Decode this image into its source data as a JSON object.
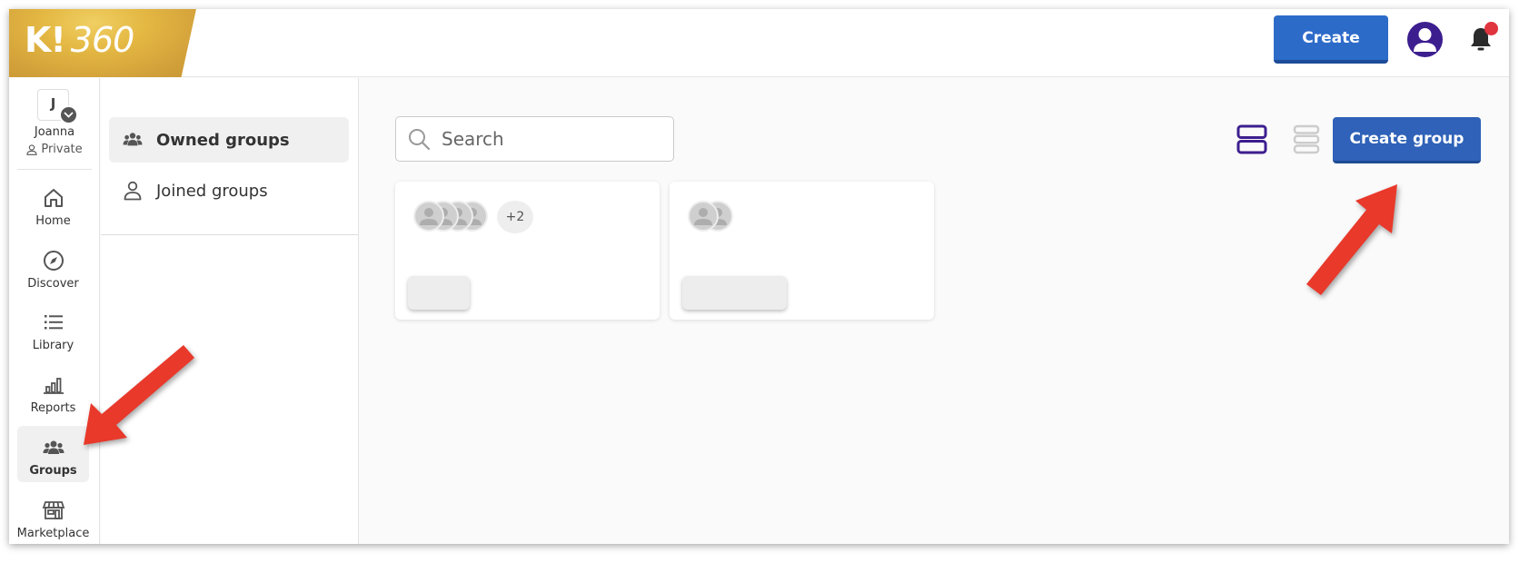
{
  "header": {
    "logo_k": "K!",
    "logo_num": "360",
    "create_label": "Create",
    "notification_dot_color": "#e0343f"
  },
  "user": {
    "initial": "J",
    "name": "Joanna",
    "privacy": "Private"
  },
  "nav": {
    "items": [
      {
        "label": "Home",
        "icon": "home-icon"
      },
      {
        "label": "Discover",
        "icon": "compass-icon"
      },
      {
        "label": "Library",
        "icon": "list-icon"
      },
      {
        "label": "Reports",
        "icon": "bar-chart-icon"
      },
      {
        "label": "Groups",
        "icon": "groups-icon",
        "active": true
      },
      {
        "label": "Marketplace",
        "icon": "store-icon"
      }
    ]
  },
  "groups_menu": {
    "items": [
      {
        "label": "Owned groups",
        "icon": "groups-icon",
        "active": true
      },
      {
        "label": "Joined groups",
        "icon": "person-icon"
      }
    ]
  },
  "main": {
    "search_placeholder": "Search",
    "create_group_label": "Create group",
    "view_mode": "grid",
    "cards": [
      {
        "member_avatars": 4,
        "more_count": "+2"
      },
      {
        "member_avatars": 2,
        "more_count": null
      }
    ]
  },
  "colors": {
    "primary_button": "#2d6bc9",
    "brand_purple": "#3d1e8f",
    "annotation_red": "#e8392b",
    "logo_gold": "#d9aa3e"
  }
}
